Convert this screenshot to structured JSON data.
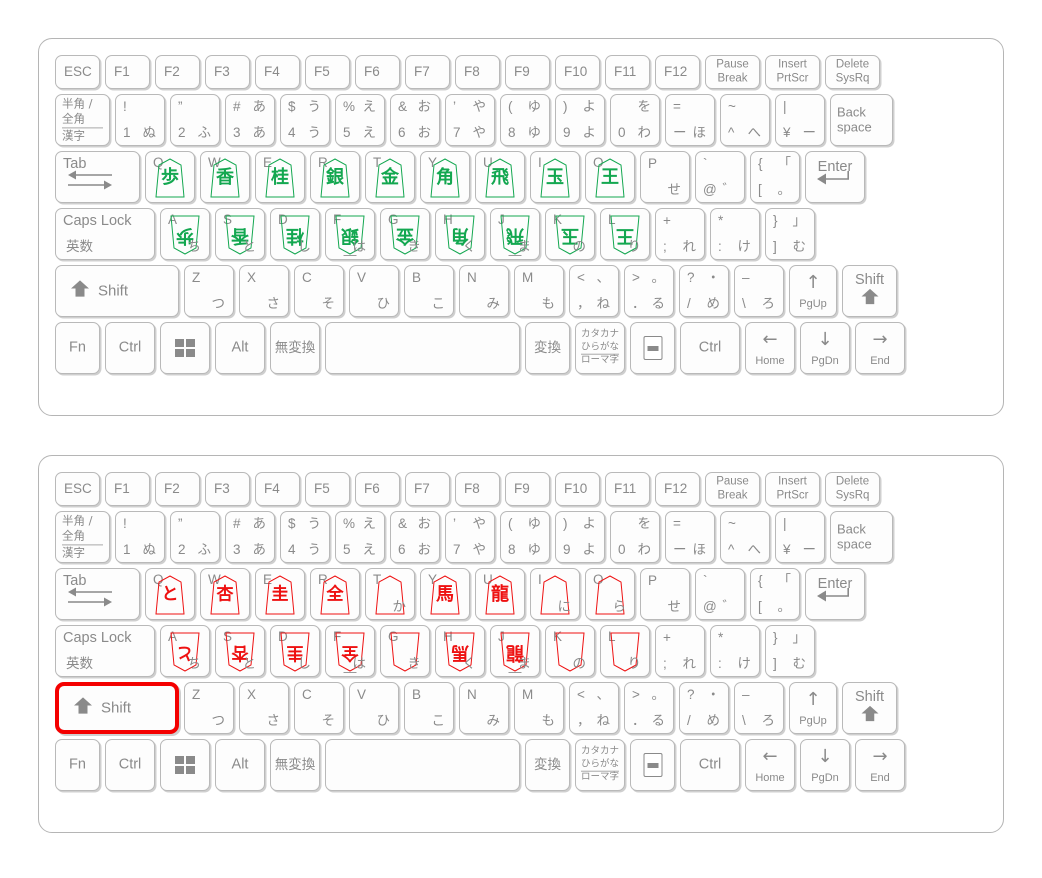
{
  "meta": {
    "description": "Japanese JIS laptop keyboard layout shown twice, annotated with shogi piece glyphs on the QWERTY and home rows",
    "accent_highlight_color": "#f40000",
    "piece_color_top": "#13a750",
    "piece_color_bottom": "#ee1111",
    "key_border_color": "#b9b9b9",
    "text_color": "#8a8a8a"
  },
  "keyboards": [
    {
      "id": "keyboard-1",
      "piece_color": "#13a750",
      "piece_set": "unpromoted",
      "highlighted_key": null
    },
    {
      "id": "keyboard-2",
      "piece_color": "#ee1111",
      "piece_set": "promoted",
      "highlighted_key": "left-shift"
    }
  ],
  "rows": {
    "function": [
      {
        "name": "esc",
        "main": "ESC"
      },
      {
        "name": "f1",
        "main": "F1"
      },
      {
        "name": "f2",
        "main": "F2"
      },
      {
        "name": "f3",
        "main": "F3"
      },
      {
        "name": "f4",
        "main": "F4"
      },
      {
        "name": "f5",
        "main": "F5"
      },
      {
        "name": "f6",
        "main": "F6"
      },
      {
        "name": "f7",
        "main": "F7"
      },
      {
        "name": "f8",
        "main": "F8"
      },
      {
        "name": "f9",
        "main": "F9"
      },
      {
        "name": "f10",
        "main": "F10"
      },
      {
        "name": "f11",
        "main": "F11"
      },
      {
        "name": "f12",
        "main": "F12"
      },
      {
        "name": "pause-break",
        "line1": "Pause",
        "line2": "Break"
      },
      {
        "name": "insert-prtscr",
        "line1": "Insert",
        "line2": "PrtScr"
      },
      {
        "name": "delete-sysrq",
        "line1": "Delete",
        "line2": "SysRq"
      }
    ],
    "number": [
      {
        "name": "hankaku-zenkaku-kanji",
        "l1": "半角 /",
        "l2": "全角",
        "l3": "漢字"
      },
      {
        "name": "digit-1",
        "tl": "!",
        "bl": "1",
        "br": "ぬ"
      },
      {
        "name": "digit-2",
        "tl": "”",
        "bl": "2",
        "br": "ふ"
      },
      {
        "name": "digit-3",
        "tl": "#",
        "tr": "あ",
        "bl": "3",
        "br": "あ"
      },
      {
        "name": "digit-4",
        "tl": "$",
        "tr": "う",
        "bl": "4",
        "br": "う"
      },
      {
        "name": "digit-5",
        "tl": "%",
        "tr": "え",
        "bl": "5",
        "br": "え"
      },
      {
        "name": "digit-6",
        "tl": "&",
        "tr": "お",
        "bl": "6",
        "br": "お"
      },
      {
        "name": "digit-7",
        "tl": "’",
        "tr": "や",
        "bl": "7",
        "br": "や"
      },
      {
        "name": "digit-8",
        "tl": "(",
        "tr": "ゆ",
        "bl": "8",
        "br": "ゆ"
      },
      {
        "name": "digit-9",
        "tl": ")",
        "tr": "よ",
        "bl": "9",
        "br": "よ"
      },
      {
        "name": "digit-0",
        "tr": "を",
        "bl": "0",
        "br": "わ"
      },
      {
        "name": "minus",
        "tl": "=",
        "bl": "ー",
        "br": "ほ"
      },
      {
        "name": "caret",
        "tl": "~",
        "bl": "^",
        "br": "へ"
      },
      {
        "name": "yen",
        "tl": "|",
        "bl": "¥",
        "br": "ー"
      },
      {
        "name": "backspace",
        "line1": "Back",
        "line2": "space"
      }
    ],
    "qwerty": [
      {
        "name": "tab",
        "main": "Tab",
        "icon": "tab-arrows-icon"
      },
      {
        "name": "key-q",
        "letter": "Q",
        "piece_green": "歩",
        "piece_red": "と",
        "piece_red_nari": true
      },
      {
        "name": "key-w",
        "letter": "W",
        "piece_green": "香",
        "piece_red": "杏",
        "piece_red_nari": true
      },
      {
        "name": "key-e",
        "letter": "E",
        "piece_green": "桂",
        "piece_red": "圭",
        "piece_red_nari": true
      },
      {
        "name": "key-r",
        "letter": "R",
        "piece_green": "銀",
        "piece_red": "全",
        "piece_red_nari": true
      },
      {
        "name": "key-t",
        "letter": "T",
        "piece_green": "金",
        "piece_red": "",
        "kana_red": "か"
      },
      {
        "name": "key-y",
        "letter": "Y",
        "piece_green": "角",
        "piece_red": "馬"
      },
      {
        "name": "key-u",
        "letter": "U",
        "piece_green": "飛",
        "piece_red": "龍"
      },
      {
        "name": "key-i",
        "letter": "I",
        "piece_green": "玉",
        "piece_red": "",
        "kana_red": "に"
      },
      {
        "name": "key-o",
        "letter": "O",
        "piece_green": "王",
        "piece_red": "",
        "kana_red": "ら"
      },
      {
        "name": "key-p",
        "tl": "P",
        "br": "せ"
      },
      {
        "name": "at",
        "tl": "`",
        "bl": "@",
        "br": "゛"
      },
      {
        "name": "bracket-left",
        "tl": "{",
        "tr": "「",
        "bl": "[",
        "br": "。"
      },
      {
        "name": "enter",
        "main": "Enter",
        "icon": "enter-arrow-icon"
      }
    ],
    "home": [
      {
        "name": "caps-lock",
        "line1": "Caps Lock",
        "line2": "英数"
      },
      {
        "name": "key-a",
        "letter": "A",
        "piece_green": "歩",
        "piece_red": "と",
        "piece_red_nari": true,
        "kana": "ち"
      },
      {
        "name": "key-s",
        "letter": "S",
        "piece_green": "香",
        "piece_red": "杏",
        "piece_red_nari": true,
        "kana": "と"
      },
      {
        "name": "key-d",
        "letter": "D",
        "piece_green": "桂",
        "piece_red": "圭",
        "piece_red_nari": true,
        "kana": "し"
      },
      {
        "name": "key-f",
        "letter": "F",
        "piece_green": "銀",
        "piece_red": "全",
        "piece_red_nari": true,
        "kana": "は",
        "homebar": true
      },
      {
        "name": "key-g",
        "letter": "G",
        "piece_green": "金",
        "piece_red": "",
        "kana": "き"
      },
      {
        "name": "key-h",
        "letter": "H",
        "piece_green": "角",
        "piece_red": "馬",
        "kana": "く"
      },
      {
        "name": "key-j",
        "letter": "J",
        "piece_green": "飛",
        "piece_red": "龍",
        "kana": "ま",
        "homebar": true
      },
      {
        "name": "key-k",
        "letter": "K",
        "piece_green": "玉",
        "piece_red": "",
        "kana": "の"
      },
      {
        "name": "key-l",
        "letter": "L",
        "piece_green": "王",
        "piece_red": "",
        "kana": "り"
      },
      {
        "name": "semicolon",
        "tl": "+",
        "bl": ";",
        "br": "れ"
      },
      {
        "name": "colon",
        "tl": "*",
        "bl": ":",
        "br": "け"
      },
      {
        "name": "bracket-right",
        "tl": "}",
        "tr": "」",
        "bl": "]",
        "br": "む"
      }
    ],
    "shift": [
      {
        "name": "left-shift",
        "main": "Shift",
        "icon": "shift-arrow-icon"
      },
      {
        "name": "key-z",
        "tl": "Z",
        "br": "つ"
      },
      {
        "name": "key-x",
        "tl": "X",
        "br": "さ"
      },
      {
        "name": "key-c",
        "tl": "C",
        "br": "そ"
      },
      {
        "name": "key-v",
        "tl": "V",
        "br": "ひ"
      },
      {
        "name": "key-b",
        "tl": "B",
        "br": "こ"
      },
      {
        "name": "key-n",
        "tl": "N",
        "br": "み"
      },
      {
        "name": "key-m",
        "tl": "M",
        "br": "も"
      },
      {
        "name": "comma",
        "tl": "<",
        "tr": "、",
        "bl": "，",
        "br": "ね"
      },
      {
        "name": "period",
        "tl": ">",
        "tr": "。",
        "bl": "．",
        "br": "る"
      },
      {
        "name": "slash",
        "tl": "?",
        "tr": "・",
        "bl": "/",
        "br": "め"
      },
      {
        "name": "backslash",
        "tl": "–",
        "bl": "\\",
        "br": "ろ"
      },
      {
        "name": "arrow-up-pgup",
        "icon": "arrow-up-icon",
        "sub": "PgUp"
      },
      {
        "name": "right-shift",
        "main": "Shift",
        "icon": "shift-arrow-icon"
      }
    ],
    "bottom": [
      {
        "name": "fn",
        "main": "Fn"
      },
      {
        "name": "ctrl-left",
        "main": "Ctrl"
      },
      {
        "name": "windows",
        "icon": "windows-logo-icon"
      },
      {
        "name": "alt",
        "main": "Alt"
      },
      {
        "name": "muhenkan",
        "main": "無変換"
      },
      {
        "name": "space",
        "main": ""
      },
      {
        "name": "henkan",
        "main": "変換"
      },
      {
        "name": "katakana-hiragana-romaji",
        "l1": "カタカナ",
        "l2": "ひらがな",
        "l3": "ローマ字"
      },
      {
        "name": "context-menu",
        "icon": "menu-icon"
      },
      {
        "name": "ctrl-right",
        "main": "Ctrl"
      },
      {
        "name": "arrow-left-home",
        "icon": "arrow-left-icon",
        "sub": "Home"
      },
      {
        "name": "arrow-down-pgdn",
        "icon": "arrow-down-icon",
        "sub": "PgDn"
      },
      {
        "name": "arrow-right-end",
        "icon": "arrow-right-icon",
        "sub": "End"
      }
    ]
  }
}
